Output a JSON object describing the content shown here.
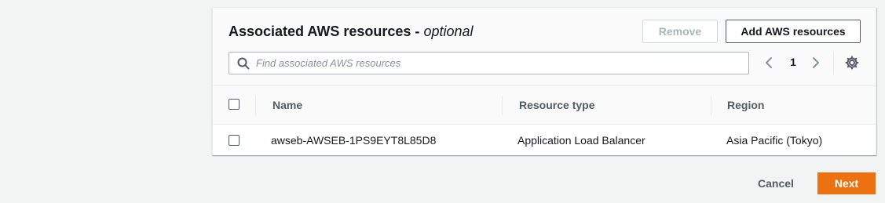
{
  "panel": {
    "title": "Associated AWS resources - ",
    "title_optional": "optional",
    "remove_label": "Remove",
    "add_label": "Add AWS resources"
  },
  "search": {
    "placeholder": "Find associated AWS resources",
    "icon": "search-icon"
  },
  "pagination": {
    "current_page": "1",
    "prev_icon": "chevron-left-icon",
    "next_icon": "chevron-right-icon",
    "settings_icon": "gear-icon"
  },
  "table": {
    "columns": [
      "Name",
      "Resource type",
      "Region"
    ],
    "rows": [
      {
        "name": "awseb-AWSEB-1PS9EYT8L85D8",
        "resource_type": "Application Load Balancer",
        "region": "Asia Pacific (Tokyo)"
      }
    ]
  },
  "footer": {
    "cancel_label": "Cancel",
    "next_label": "Next"
  },
  "colors": {
    "primary_button": "#ec7211",
    "disabled_text": "#aab7b8",
    "background": "#f2f3f3"
  }
}
